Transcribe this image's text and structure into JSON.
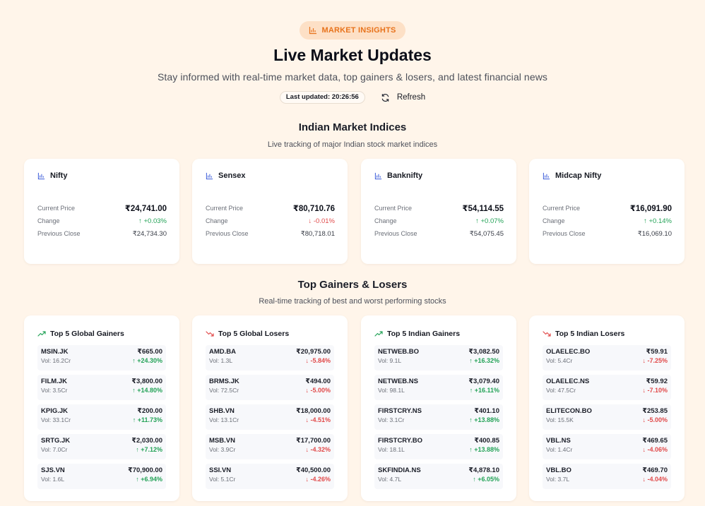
{
  "header": {
    "badge": "MARKET INSIGHTS",
    "title": "Live Market Updates",
    "subtitle": "Stay informed with real-time market data, top gainers & losers, and latest financial news",
    "last_updated": "Last updated: 20:26:56",
    "refresh_label": "Refresh"
  },
  "indices_section": {
    "title": "Indian Market Indices",
    "subtitle": "Live tracking of major Indian stock market indices",
    "labels": {
      "current": "Current Price",
      "change": "Change",
      "previous": "Previous Close"
    },
    "items": [
      {
        "name": "Nifty",
        "current": "₹24,741.00",
        "change": "↑ +0.03%",
        "direction": "up",
        "previous": "₹24,734.30"
      },
      {
        "name": "Sensex",
        "current": "₹80,710.76",
        "change": "↓ -0.01%",
        "direction": "down",
        "previous": "₹80,718.01"
      },
      {
        "name": "Banknifty",
        "current": "₹54,114.55",
        "change": "↑ +0.07%",
        "direction": "up",
        "previous": "₹54,075.45"
      },
      {
        "name": "Midcap Nifty",
        "current": "₹16,091.90",
        "change": "↑ +0.14%",
        "direction": "up",
        "previous": "₹16,069.10"
      }
    ]
  },
  "movers_section": {
    "title": "Top Gainers & Losers",
    "subtitle": "Real-time tracking of best and worst performing stocks",
    "cards": [
      {
        "title": "Top 5 Global Gainers",
        "type": "gainers",
        "stocks": [
          {
            "symbol": "MSIN.JK",
            "volume": "Vol: 16.2Cr",
            "price": "₹665.00",
            "change": "↑ +24.30%"
          },
          {
            "symbol": "FILM.JK",
            "volume": "Vol: 3.5Cr",
            "price": "₹3,800.00",
            "change": "↑ +14.80%"
          },
          {
            "symbol": "KPIG.JK",
            "volume": "Vol: 33.1Cr",
            "price": "₹200.00",
            "change": "↑ +11.73%"
          },
          {
            "symbol": "SRTG.JK",
            "volume": "Vol: 7.0Cr",
            "price": "₹2,030.00",
            "change": "↑ +7.12%"
          },
          {
            "symbol": "SJS.VN",
            "volume": "Vol: 1.6L",
            "price": "₹70,900.00",
            "change": "↑ +6.94%"
          }
        ]
      },
      {
        "title": "Top 5 Global Losers",
        "type": "losers",
        "stocks": [
          {
            "symbol": "AMD.BA",
            "volume": "Vol: 1.3L",
            "price": "₹20,975.00",
            "change": "↓ -5.84%"
          },
          {
            "symbol": "BRMS.JK",
            "volume": "Vol: 72.5Cr",
            "price": "₹494.00",
            "change": "↓ -5.00%"
          },
          {
            "symbol": "SHB.VN",
            "volume": "Vol: 13.1Cr",
            "price": "₹18,000.00",
            "change": "↓ -4.51%"
          },
          {
            "symbol": "MSB.VN",
            "volume": "Vol: 3.9Cr",
            "price": "₹17,700.00",
            "change": "↓ -4.32%"
          },
          {
            "symbol": "SSI.VN",
            "volume": "Vol: 5.1Cr",
            "price": "₹40,500.00",
            "change": "↓ -4.26%"
          }
        ]
      },
      {
        "title": "Top 5 Indian Gainers",
        "type": "gainers",
        "stocks": [
          {
            "symbol": "NETWEB.BO",
            "volume": "Vol: 9.1L",
            "price": "₹3,082.50",
            "change": "↑ +16.32%"
          },
          {
            "symbol": "NETWEB.NS",
            "volume": "Vol: 98.1L",
            "price": "₹3,079.40",
            "change": "↑ +16.11%"
          },
          {
            "symbol": "FIRSTCRY.NS",
            "volume": "Vol: 3.1Cr",
            "price": "₹401.10",
            "change": "↑ +13.88%"
          },
          {
            "symbol": "FIRSTCRY.BO",
            "volume": "Vol: 18.1L",
            "price": "₹400.85",
            "change": "↑ +13.88%"
          },
          {
            "symbol": "SKFINDIA.NS",
            "volume": "Vol: 4.7L",
            "price": "₹4,878.10",
            "change": "↑ +6.05%"
          }
        ]
      },
      {
        "title": "Top 5 Indian Losers",
        "type": "losers",
        "stocks": [
          {
            "symbol": "OLAELEC.BO",
            "volume": "Vol: 5.4Cr",
            "price": "₹59.91",
            "change": "↓ -7.25%"
          },
          {
            "symbol": "OLAELEC.NS",
            "volume": "Vol: 47.5Cr",
            "price": "₹59.92",
            "change": "↓ -7.10%"
          },
          {
            "symbol": "ELITECON.BO",
            "volume": "Vol: 15.5K",
            "price": "₹253.85",
            "change": "↓ -5.00%"
          },
          {
            "symbol": "VBL.NS",
            "volume": "Vol: 1.4Cr",
            "price": "₹469.65",
            "change": "↓ -4.06%"
          },
          {
            "symbol": "VBL.BO",
            "volume": "Vol: 3.7L",
            "price": "₹469.70",
            "change": "↓ -4.04%"
          }
        ]
      }
    ]
  },
  "colors": {
    "accent": "#e8731c",
    "badge_bg": "#fde0c6",
    "up": "#23a257",
    "down": "#e14a4a",
    "page_bg": "#fff5ea"
  },
  "icons": {
    "badge": "bar-chart-icon",
    "refresh": "refresh-icon",
    "index": "bar-chart-icon",
    "gainers": "trending-up-icon",
    "losers": "trending-down-icon"
  }
}
